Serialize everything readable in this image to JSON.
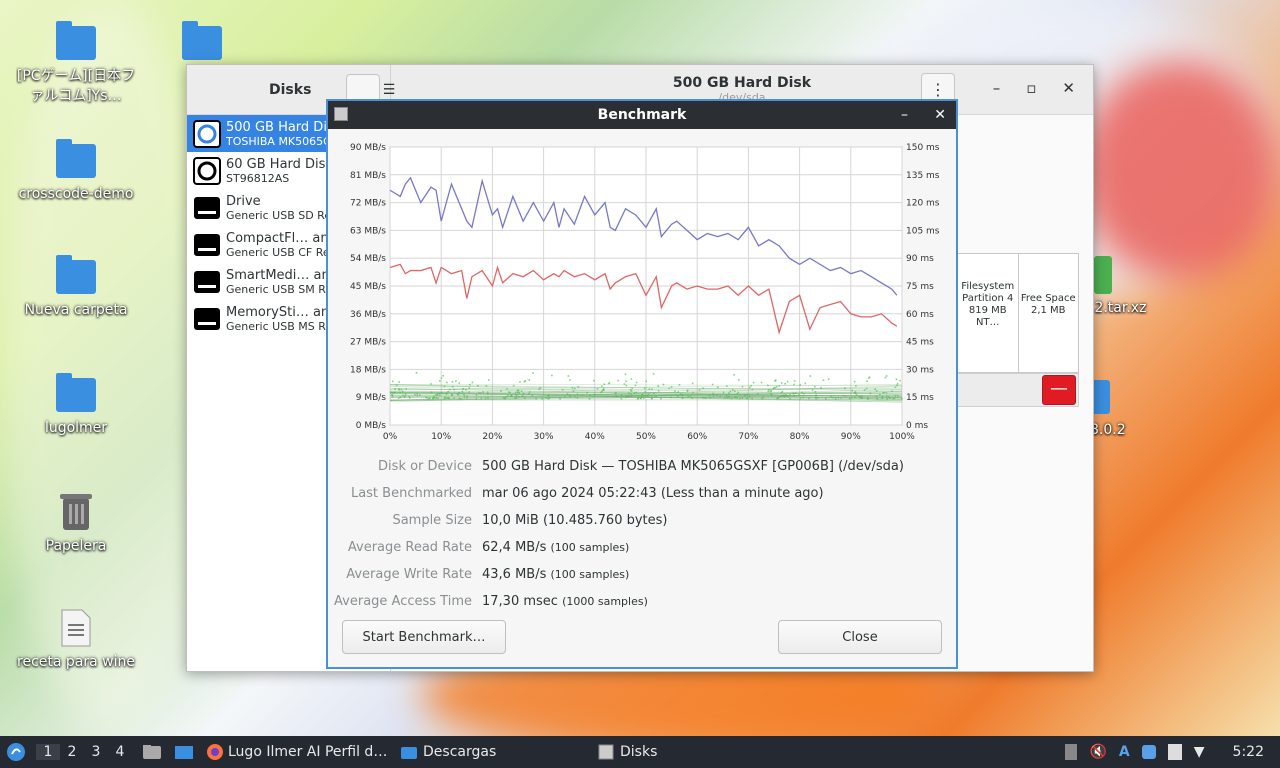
{
  "desktop": {
    "icons": [
      {
        "label": "[PCゲーム][日本ファルコム]Ys…"
      },
      {
        "label": "crosscode-demo"
      },
      {
        "label": "Nueva carpeta"
      },
      {
        "label": "lugolmer"
      },
      {
        "label": "Papelera"
      },
      {
        "label": "receta para wine"
      },
      {
        "label": ".2.tar.xz"
      },
      {
        "label": "8.0.2"
      }
    ]
  },
  "disks_window": {
    "sidebar_title": "Disks",
    "title": "500 GB Hard Disk",
    "subtitle": "/dev/sda",
    "devices": [
      {
        "name": "500 GB Hard Disk",
        "sub": "TOSHIBA MK5065GSXF",
        "selected": true
      },
      {
        "name": "60 GB Hard Disk",
        "sub": "ST96812AS"
      },
      {
        "name": "Drive",
        "sub": "Generic USB SD Reader"
      },
      {
        "name": "CompactFl… and",
        "sub": "Generic USB CF Reader"
      },
      {
        "name": "SmartMedi… and",
        "sub": "Generic USB SM Reader"
      },
      {
        "name": "MemorySti… and",
        "sub": "Generic USB MS Reader"
      }
    ],
    "partitions": [
      {
        "line1": "Filesystem",
        "line2": "Partition 4",
        "line3": "819 MB NT…"
      },
      {
        "line1": "Free Space",
        "line2": "2,1 MB",
        "line3": ""
      }
    ]
  },
  "benchmark": {
    "title": "Benchmark",
    "info": [
      {
        "key": "Disk or Device",
        "value": "500 GB Hard Disk — TOSHIBA MK5065GSXF [GP006B] (/dev/sda)",
        "note": ""
      },
      {
        "key": "Last Benchmarked",
        "value": "mar 06 ago 2024 05:22:43 (Less than a minute ago)",
        "note": ""
      },
      {
        "key": "Sample Size",
        "value": "10,0 MiB (10.485.760 bytes)",
        "note": ""
      },
      {
        "key": "Average Read Rate",
        "value": "62,4 MB/s",
        "note": "(100 samples)"
      },
      {
        "key": "Average Write Rate",
        "value": "43,6 MB/s",
        "note": "(100 samples)"
      },
      {
        "key": "Average Access Time",
        "value": "17,30 msec",
        "note": "(1000 samples)"
      }
    ],
    "start_button": "Start Benchmark…",
    "close_button": "Close"
  },
  "chart_data": {
    "type": "line",
    "x_ticks": [
      "0%",
      "10%",
      "20%",
      "30%",
      "40%",
      "50%",
      "60%",
      "70%",
      "80%",
      "90%",
      "100%"
    ],
    "y_left_ticks": [
      "0 MB/s",
      "9 MB/s",
      "18 MB/s",
      "27 MB/s",
      "36 MB/s",
      "45 MB/s",
      "54 MB/s",
      "63 MB/s",
      "72 MB/s",
      "81 MB/s",
      "90 MB/s"
    ],
    "y_right_ticks": [
      "0 ms",
      "15 ms",
      "30 ms",
      "45 ms",
      "60 ms",
      "75 ms",
      "90 ms",
      "105 ms",
      "120 ms",
      "135 ms",
      "150 ms"
    ],
    "ylim_left": [
      0,
      90
    ],
    "ylim_right": [
      0,
      150
    ],
    "xlim": [
      0,
      100
    ],
    "grid": true,
    "series": [
      {
        "color": "#7777cc",
        "axis": "left",
        "x": [
          0,
          2,
          3,
          4,
          6,
          8,
          9,
          10,
          12,
          14,
          15,
          16,
          18,
          20,
          21,
          22,
          24,
          26,
          28,
          30,
          32,
          33,
          34,
          36,
          38,
          40,
          42,
          43,
          44,
          46,
          48,
          50,
          52,
          53,
          55,
          56,
          58,
          60,
          62,
          64,
          66,
          68,
          70,
          72,
          74,
          76,
          78,
          80,
          82,
          84,
          86,
          88,
          90,
          92,
          94,
          96,
          98,
          99
        ],
        "y": [
          76,
          74,
          78,
          80,
          72,
          77,
          76,
          66,
          78,
          70,
          66,
          64,
          79,
          68,
          70,
          64,
          74,
          66,
          72,
          66,
          72,
          64,
          70,
          65,
          74,
          68,
          72,
          64,
          63,
          70,
          68,
          64,
          70,
          61,
          65,
          66,
          63,
          60,
          62,
          61,
          62,
          60,
          64,
          58,
          60,
          58,
          54,
          52,
          54,
          52,
          50,
          51,
          49,
          50,
          48,
          46,
          44,
          42
        ]
      },
      {
        "color": "#dd6666",
        "axis": "left",
        "x": [
          0,
          2,
          3,
          4,
          6,
          8,
          9,
          10,
          12,
          14,
          15,
          16,
          18,
          20,
          21,
          22,
          24,
          26,
          28,
          30,
          32,
          33,
          34,
          36,
          38,
          40,
          42,
          43,
          44,
          46,
          48,
          50,
          52,
          53,
          55,
          56,
          58,
          60,
          62,
          64,
          66,
          68,
          70,
          72,
          74,
          76,
          78,
          80,
          82,
          84,
          86,
          88,
          90,
          92,
          94,
          96,
          98,
          99
        ],
        "y": [
          51,
          52,
          49,
          50,
          50,
          51,
          46,
          51,
          49,
          50,
          41,
          48,
          50,
          45,
          51,
          46,
          49,
          48,
          50,
          47,
          49,
          48,
          50,
          48,
          49,
          47,
          49,
          44,
          46,
          48,
          49,
          42,
          48,
          38,
          45,
          46,
          44,
          45,
          44,
          44,
          45,
          42,
          45,
          42,
          44,
          30,
          40,
          42,
          31,
          38,
          39,
          40,
          36,
          35,
          35,
          36,
          33,
          32
        ]
      }
    ],
    "access_scatter": {
      "color": "#55cc55",
      "ms_min": 8,
      "ms_max": 30,
      "count": 1000
    }
  },
  "taskbar": {
    "workspaces": [
      "1",
      "2",
      "3",
      "4"
    ],
    "active_workspace": "1",
    "tasks": [
      "Lugo Ilmer AI Perfil d…",
      "Descargas",
      "Disks"
    ],
    "clock": "5:22"
  }
}
